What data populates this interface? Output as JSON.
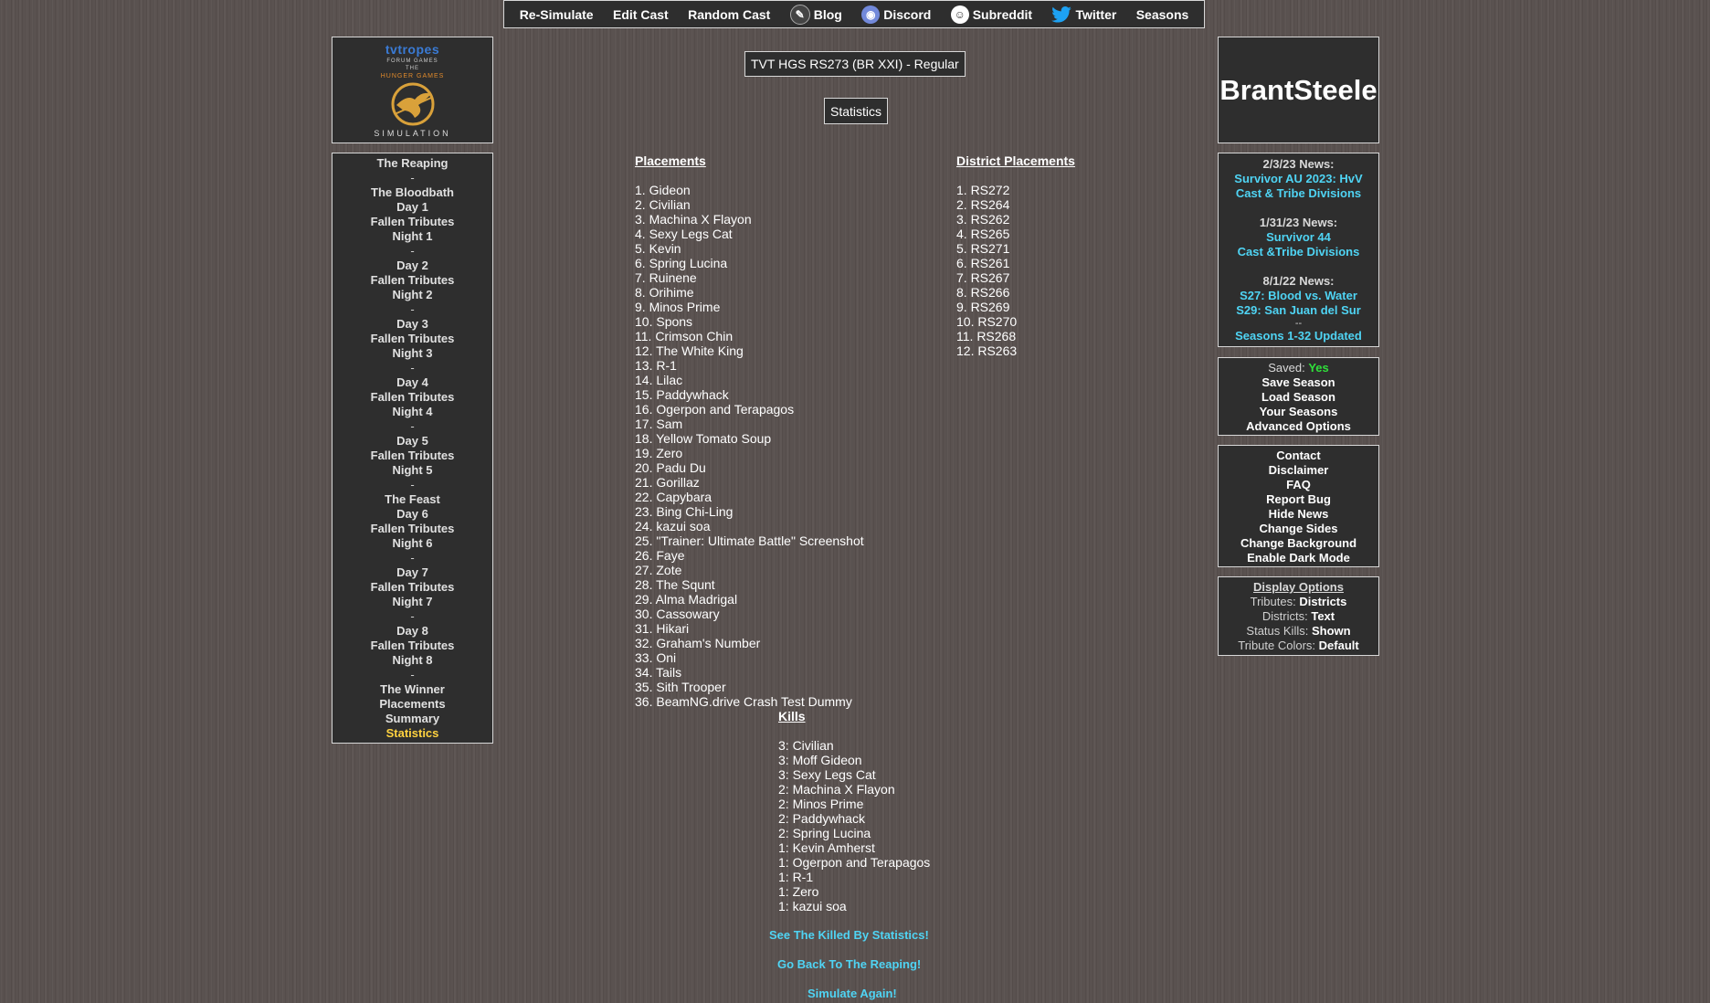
{
  "topnav": {
    "resimulate": "Re-Simulate",
    "edit_cast": "Edit Cast",
    "random_cast": "Random Cast",
    "blog": "Blog",
    "discord": "Discord",
    "subreddit": "Subreddit",
    "twitter": "Twitter",
    "seasons": "Seasons"
  },
  "logo": {
    "top": "tvtropes",
    "forum": "FORUM GAMES",
    "the": "THE",
    "hunger_games": "HUNGER GAMES",
    "simulation": "SIMULATION"
  },
  "leftnav": [
    {
      "label": "The Reaping"
    },
    {
      "sep": "-"
    },
    {
      "label": "The Bloodbath"
    },
    {
      "label": "Day 1"
    },
    {
      "label": "Fallen Tributes"
    },
    {
      "label": "Night 1"
    },
    {
      "sep": "-"
    },
    {
      "label": "Day 2"
    },
    {
      "label": "Fallen Tributes"
    },
    {
      "label": "Night 2"
    },
    {
      "sep": "-"
    },
    {
      "label": "Day 3"
    },
    {
      "label": "Fallen Tributes"
    },
    {
      "label": "Night 3"
    },
    {
      "sep": "-"
    },
    {
      "label": "Day 4"
    },
    {
      "label": "Fallen Tributes"
    },
    {
      "label": "Night 4"
    },
    {
      "sep": "-"
    },
    {
      "label": "Day 5"
    },
    {
      "label": "Fallen Tributes"
    },
    {
      "label": "Night 5"
    },
    {
      "sep": "-"
    },
    {
      "label": "The Feast"
    },
    {
      "label": "Day 6"
    },
    {
      "label": "Fallen Tributes"
    },
    {
      "label": "Night 6"
    },
    {
      "sep": "-"
    },
    {
      "label": "Day 7"
    },
    {
      "label": "Fallen Tributes"
    },
    {
      "label": "Night 7"
    },
    {
      "sep": "-"
    },
    {
      "label": "Day 8"
    },
    {
      "label": "Fallen Tributes"
    },
    {
      "label": "Night 8"
    },
    {
      "sep": "-"
    },
    {
      "label": "The Winner"
    },
    {
      "label": "Placements"
    },
    {
      "label": "Summary"
    },
    {
      "label": "Statistics",
      "active": true
    }
  ],
  "brand": "BrantSteele",
  "news": [
    {
      "date": "2/3/23 News:",
      "links": [
        "Survivor AU 2023: HvV",
        "Cast & Tribe Divisions"
      ]
    },
    {
      "date": "1/31/23 News:",
      "links": [
        "Survivor 44",
        "Cast &Tribe Divisions"
      ]
    },
    {
      "date": "8/1/22 News:",
      "links": [
        "S27: Blood vs. Water",
        "S29: San Juan del Sur"
      ]
    }
  ],
  "news_dash": "--",
  "news_footer": "Seasons 1-32 Updated",
  "save_menu": {
    "saved_label": "Saved:",
    "saved_value": "Yes",
    "items": [
      "Save Season",
      "Load Season",
      "Your Seasons",
      "Advanced Options"
    ]
  },
  "help_menu": [
    "Contact",
    "Disclaimer",
    "FAQ",
    "Report Bug",
    "Hide News",
    "Change Sides",
    "Change Background",
    "Enable Dark Mode"
  ],
  "display_options": {
    "title": "Display Options",
    "rows": [
      {
        "label": "Tributes:",
        "value": "Districts"
      },
      {
        "label": "Districts:",
        "value": "Text"
      },
      {
        "label": "Status Kills:",
        "value": "Shown"
      },
      {
        "label": "Tribute Colors:",
        "value": "Default"
      }
    ]
  },
  "season_title": "TVT HGS RS273 (BR XXI) - Regular",
  "stats_title": "Statistics",
  "placements": {
    "heading": "Placements",
    "items": [
      "1. Gideon",
      "2. Civilian",
      "3. Machina X Flayon",
      "4. Sexy Legs Cat",
      "5. Kevin",
      "6. Spring Lucina",
      "7. Ruinene",
      "8. Orihime",
      "9. Minos Prime",
      "10. Spons",
      "11. Crimson Chin",
      "12. The White King",
      "13. R-1",
      "14. Lilac",
      "15. Paddywhack",
      "16. Ogerpon and Terapagos",
      "17. Sam",
      "18. Yellow Tomato Soup",
      "19. Zero",
      "20. Padu Du",
      "21. Gorillaz",
      "22. Capybara",
      "23. Bing Chi-Ling",
      "24. kazui soa",
      "25. \"Trainer: Ultimate Battle\" Screenshot",
      "26. Faye",
      "27. Zote",
      "28. The Squnt",
      "29. Alma Madrigal",
      "30. Cassowary",
      "31. Hikari",
      "32. Graham's Number",
      "33. Oni",
      "34. Tails",
      "35. Sith Trooper",
      "36. BeamNG.drive Crash Test Dummy"
    ]
  },
  "district_placements": {
    "heading": "District Placements",
    "items": [
      "1. RS272",
      "2. RS264",
      "3. RS262",
      "4. RS265",
      "5. RS271",
      "6. RS261",
      "7. RS267",
      "8. RS266",
      "9. RS269",
      "10. RS270",
      "11. RS268",
      "12. RS263"
    ]
  },
  "kills": {
    "heading": "Kills",
    "items": [
      "3: Civilian",
      "3: Moff Gideon",
      "3: Sexy Legs Cat",
      "2: Machina X Flayon",
      "2: Minos Prime",
      "2: Paddywhack",
      "2: Spring Lucina",
      "1: Kevin Amherst",
      "1: Ogerpon and Terapagos",
      "1: R-1",
      "1: Zero",
      "1: kazui soa"
    ]
  },
  "bottom_links": {
    "killed_by": "See The Killed By Statistics!",
    "go_back": "Go Back To The Reaping!",
    "simulate": "Simulate Again!"
  },
  "colors": {
    "panel": "#2e2e2e",
    "border": "#d8d8d8",
    "link_cyan": "#4fd4f4",
    "active_yellow": "#ffd23f",
    "saved_green": "#2fe03a"
  }
}
